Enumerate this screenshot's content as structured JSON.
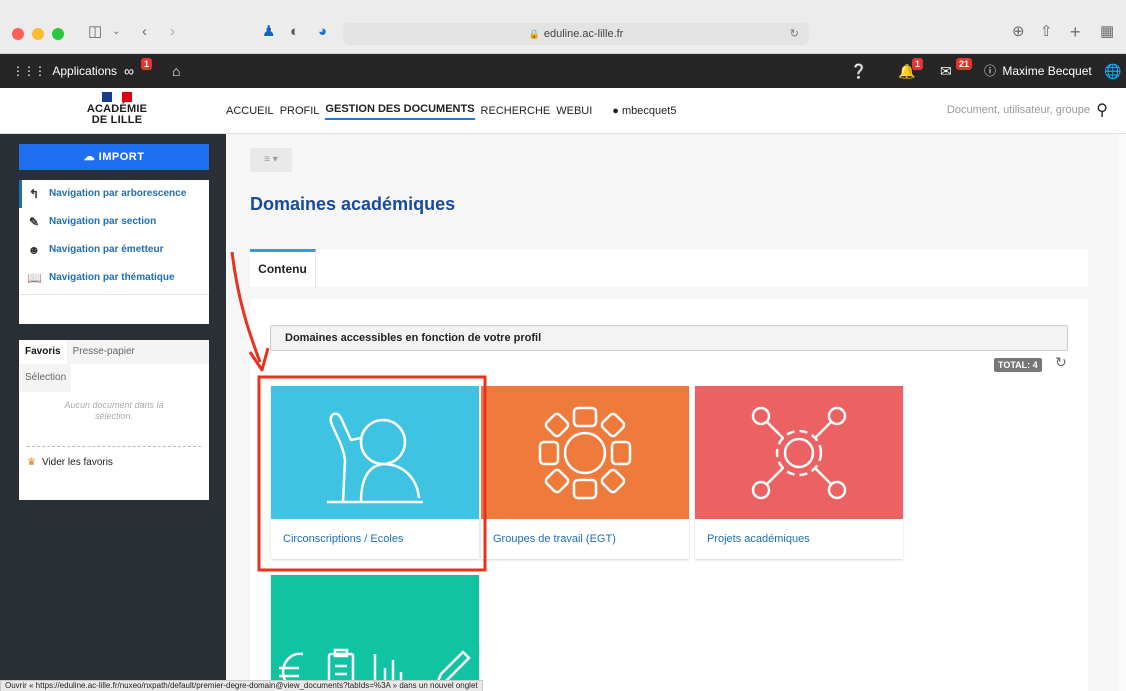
{
  "colors": {
    "accent_blue": "#1e6ff0",
    "title_blue": "#1a4a9c",
    "link_blue": "#1d6fb8",
    "sidebar_bg": "#2a2f35",
    "appbar_bg": "#262626",
    "tile_blue": "#3ec3e3",
    "tile_orange": "#ee7a3c",
    "tile_red": "#ec6161",
    "tile_green": "#10c3a3",
    "annotation_red": "#e8321e"
  },
  "browser": {
    "url": "eduline.ac-lille.fr",
    "icons": [
      "sidebar-icon",
      "back-icon",
      "forward-icon",
      "reload-icon",
      "download-icon",
      "share-icon",
      "new-tab-icon",
      "tab-overview-icon"
    ]
  },
  "appbar": {
    "applications_label": "Applications",
    "apps_badge": "1",
    "notifications_badge": "1",
    "messages_badge": "21",
    "user_name": "Maxime Becquet"
  },
  "header": {
    "logo_line1": "ACADÉMIE",
    "logo_line2": "DE LILLE",
    "nav": [
      "ACCUEIL",
      "PROFIL",
      "GESTION DES DOCUMENTS",
      "RECHERCHE",
      "WEBUI"
    ],
    "active_nav": "GESTION DES DOCUMENTS",
    "username": "mbecquet5",
    "search_placeholder": "Document, utilisateur, groupe"
  },
  "sidebar": {
    "import_label": "IMPORT",
    "nav_items": [
      {
        "label": "Navigation par arborescence",
        "icon": "tree-icon"
      },
      {
        "label": "Navigation par section",
        "icon": "section-icon"
      },
      {
        "label": "Navigation par émetteur",
        "icon": "sender-icon"
      },
      {
        "label": "Navigation par thématique",
        "icon": "book-icon"
      }
    ],
    "fav_tabs": [
      "Favoris",
      "Presse-papier",
      "Sélection"
    ],
    "empty_text": "Aucun document dans la sélection.",
    "clear_label": "Vider les favoris"
  },
  "main": {
    "title": "Domaines académiques",
    "tab_label": "Contenu",
    "section_header": "Domaines accessibles en fonction de votre profil",
    "total_label": "TOTAL: 4",
    "tiles": [
      {
        "label": "Circonscriptions / Ecoles",
        "icon": "raised-hand-icon"
      },
      {
        "label": "Groupes de travail (EGT)",
        "icon": "linked-hands-icon"
      },
      {
        "label": "Projets académiques",
        "icon": "network-gear-icon"
      },
      {
        "label": "",
        "icon": "finance-tools-icon"
      }
    ]
  },
  "status_text": "Ouvrir « https://eduline.ac-lille.fr/nuxeo/nxpath/default/premier-degre-domain@view_documents?tabIds=%3A » dans un nouvel onglet"
}
